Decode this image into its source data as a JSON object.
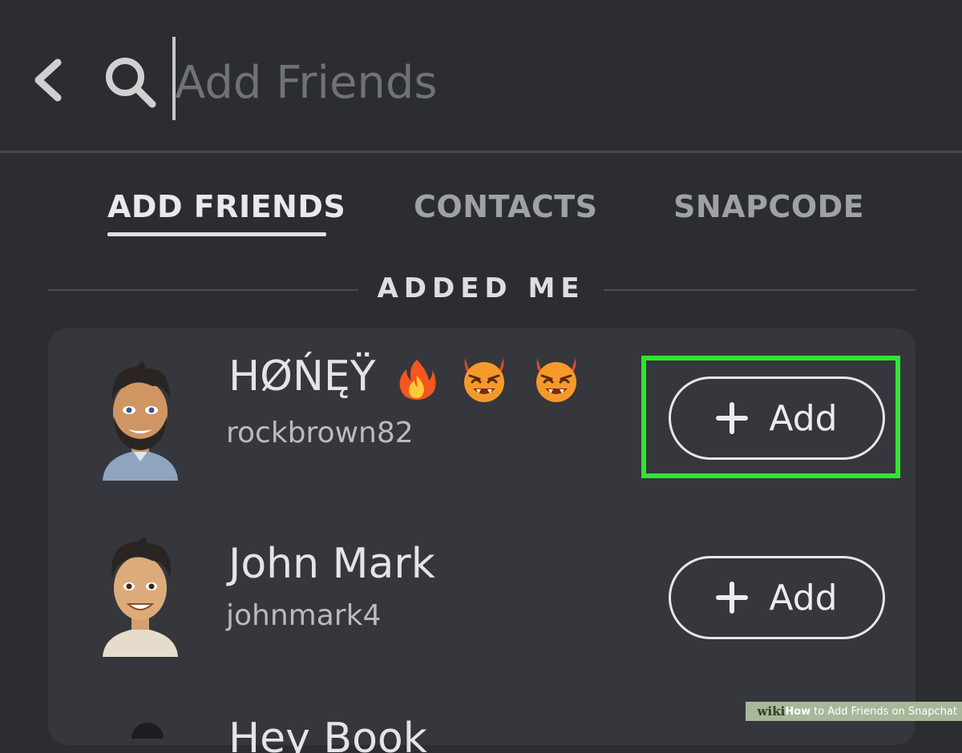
{
  "header": {
    "search_placeholder": "Add Friends",
    "back_icon": "chevron-left-icon",
    "search_icon": "magnifier-icon"
  },
  "tabs": [
    {
      "label": "ADD FRIENDS",
      "active": true
    },
    {
      "label": "CONTACTS",
      "active": false
    },
    {
      "label": "SNAPCODE",
      "active": false
    }
  ],
  "section": {
    "title": "ADDED ME"
  },
  "friends": [
    {
      "display_name": "HØŃĘŸ",
      "emojis": [
        "fire",
        "smiling-devil",
        "smiling-devil"
      ],
      "username": "rockbrown82",
      "button_label": "Add",
      "highlighted": true
    },
    {
      "display_name": "John Mark",
      "emojis": [],
      "username": "johnmark4",
      "button_label": "Add",
      "highlighted": false
    },
    {
      "display_name": "Hey Book",
      "emojis": [],
      "username": "",
      "button_label": "",
      "highlighted": false
    }
  ],
  "watermark": {
    "brand": "wiki",
    "how": "How",
    "title": "to Add Friends on Snapchat"
  },
  "colors": {
    "background": "#2b2d32",
    "card": "#35373d",
    "highlight": "#31e531",
    "active_tab": "#e9e9e9",
    "inactive_tab": "#9ea1a6"
  }
}
